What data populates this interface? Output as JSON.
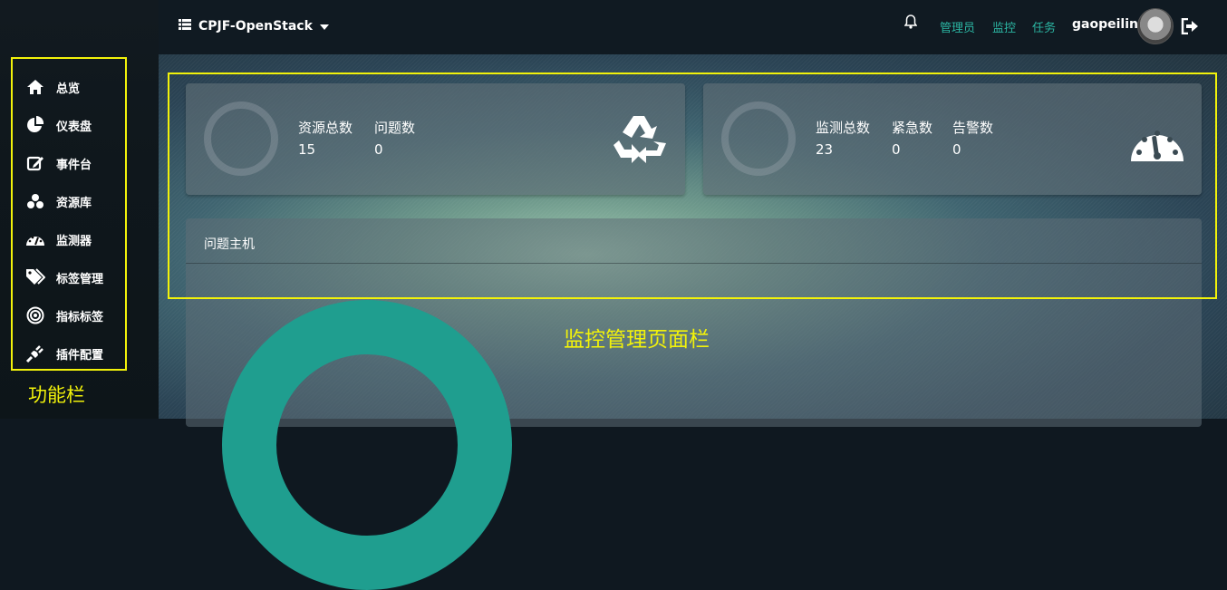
{
  "topbar": {
    "project": "CPJF-OpenStack",
    "links": [
      "管理员",
      "监控",
      "任务"
    ],
    "username": "gaopeilin"
  },
  "sidebar": {
    "items": [
      {
        "label": "总览",
        "icon": "home-icon"
      },
      {
        "label": "仪表盘",
        "icon": "pie-chart-icon"
      },
      {
        "label": "事件台",
        "icon": "edit-icon"
      },
      {
        "label": "资源库",
        "icon": "cubes-icon"
      },
      {
        "label": "监测器",
        "icon": "dashboard-icon"
      },
      {
        "label": "标签管理",
        "icon": "tags-icon"
      },
      {
        "label": "指标标签",
        "icon": "target-icon"
      },
      {
        "label": "插件配置",
        "icon": "plug-icon"
      }
    ],
    "caption": "功能栏"
  },
  "cards": [
    {
      "stats": [
        {
          "label": "资源总数",
          "value": "15"
        },
        {
          "label": "问题数",
          "value": "0"
        }
      ],
      "icon": "recycle-icon"
    },
    {
      "stats": [
        {
          "label": "监测总数",
          "value": "23"
        },
        {
          "label": "紧急数",
          "value": "0"
        },
        {
          "label": "告警数",
          "value": "0"
        }
      ],
      "icon": "dashboard-icon"
    }
  ],
  "issues_panel": {
    "title": "问题主机"
  },
  "main_caption": "监控管理页面栏",
  "colors": {
    "accent": "#2bb5a2",
    "annotation": "#f2f20a",
    "donut": "#1f9e8f"
  }
}
